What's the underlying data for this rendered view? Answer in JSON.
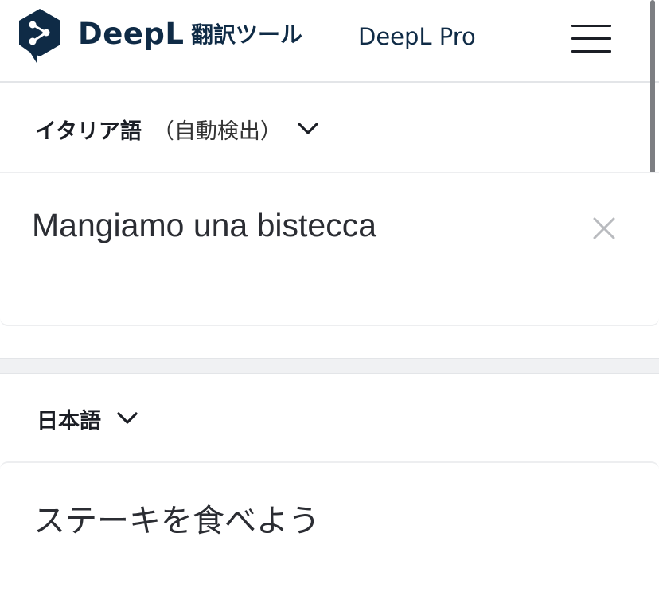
{
  "header": {
    "brand": "DeepL",
    "brand_sub": "翻訳ツール",
    "pro_link": "DeepL Pro",
    "logo_icon": "deepl-share-logo-icon",
    "menu_icon": "hamburger-menu-icon"
  },
  "source": {
    "language": "イタリア語",
    "detect_note": "（自動検出）",
    "text": "Mangiamo una bistecca",
    "chevron_icon": "chevron-down-icon",
    "clear_icon": "close-icon"
  },
  "target": {
    "language": "日本語",
    "text": "ステーキを食べよう",
    "chevron_icon": "chevron-down-icon"
  },
  "colors": {
    "brand_navy": "#0f2b46",
    "text_dark": "#1b1e25",
    "divider_gray": "#f0f1f3",
    "clear_icon_gray": "#b9bbbf"
  }
}
